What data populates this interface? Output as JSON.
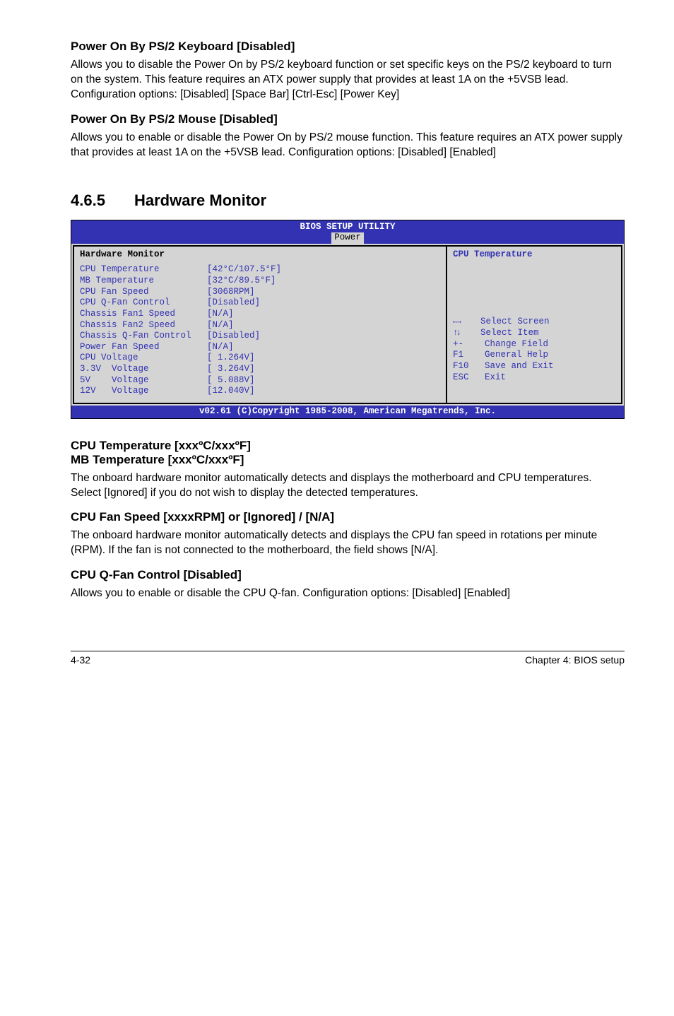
{
  "sections": {
    "kbd": {
      "title": "Power On By PS/2 Keyboard [Disabled]",
      "body1": "Allows you to disable the Power On by PS/2 keyboard function or set specific keys on the PS/2 keyboard to turn on the system. This feature requires an ATX power supply that provides at least 1A on the +5VSB lead.",
      "body2": "Configuration options: [Disabled] [Space Bar] [Ctrl-Esc] [Power Key]"
    },
    "mouse": {
      "title": "Power On By PS/2 Mouse [Disabled]",
      "body1": "Allows you to enable or disable the Power On by PS/2 mouse function. This feature requires an ATX power supply that provides at least 1A on the +5VSB lead. Configuration options: [Disabled] [Enabled]"
    },
    "hwmon": {
      "num": "4.6.5",
      "title": "Hardware Monitor"
    },
    "cputemp": {
      "title1": "CPU Temperature [xxxºC/xxxºF]",
      "title2": "MB Temperature [xxxºC/xxxºF]",
      "body": "The onboard hardware monitor automatically detects and displays the motherboard and CPU temperatures. Select [Ignored] if you do not wish to display the detected temperatures."
    },
    "fanspeed": {
      "title": "CPU Fan Speed [xxxxRPM] or [Ignored] / [N/A]",
      "body": "The onboard hardware monitor automatically detects and displays the CPU fan speed in rotations per minute (RPM). If the fan is not connected to the motherboard, the field shows [N/A]."
    },
    "qfan": {
      "title": "CPU Q-Fan Control [Disabled]",
      "body": "Allows you to enable or disable the CPU Q-fan. Configuration options: [Disabled] [Enabled]"
    }
  },
  "bios": {
    "title": "BIOS SETUP UTILITY",
    "tab": "Power",
    "panel_heading": "Hardware Monitor",
    "rows": [
      "CPU Temperature         [42°C/107.5°F]",
      "MB Temperature          [32°C/89.5°F]",
      "",
      "CPU Fan Speed           [3068RPM]",
      "CPU Q-Fan Control       [Disabled]",
      "",
      "",
      "Chassis Fan1 Speed      [N/A]",
      "Chassis Fan2 Speed      [N/A]",
      "Chassis Q-Fan Control   [Disabled]",
      "",
      "Power Fan Speed         [N/A]",
      "",
      "CPU Voltage             [ 1.264V]",
      "3.3V  Voltage           [ 3.264V]",
      "5V    Voltage           [ 5.088V]",
      "12V   Voltage           [12.040V]"
    ],
    "help_title": "CPU Temperature",
    "nav": {
      "lr": "    Select Screen",
      "ud": "    Select Item",
      "pm": "+-    Change Field",
      "f1": "F1    General Help",
      "f10": "F10   Save and Exit",
      "esc": "ESC   Exit"
    },
    "footer": "v02.61 (C)Copyright 1985-2008, American Megatrends, Inc."
  },
  "page_footer": {
    "left": "4-32",
    "right": "Chapter 4: BIOS setup"
  }
}
